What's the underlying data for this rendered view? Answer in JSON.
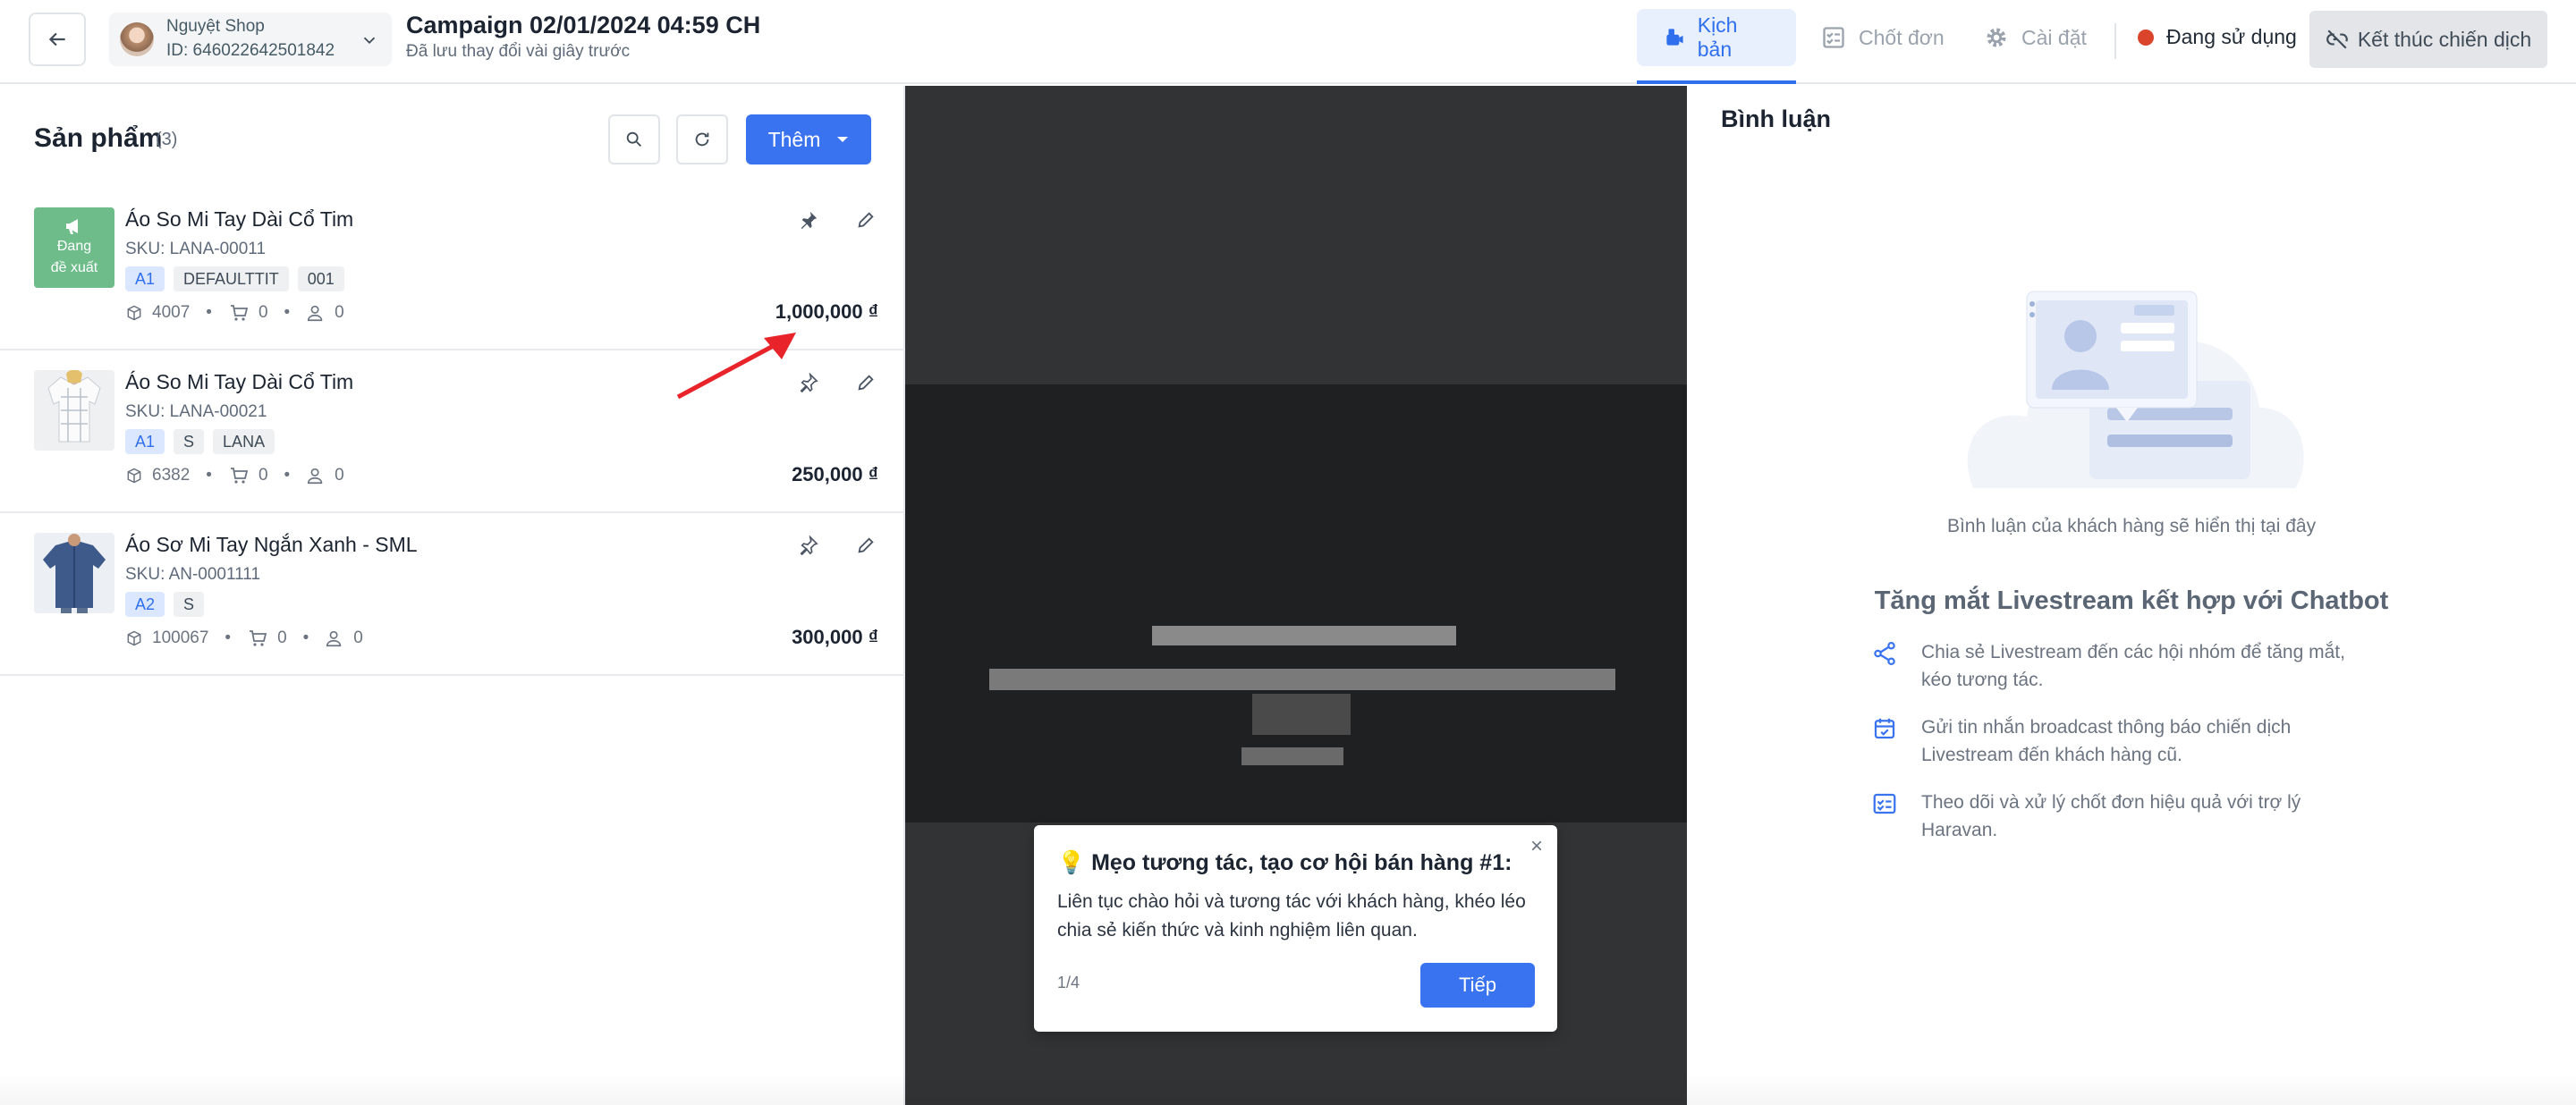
{
  "header": {
    "back_icon": "arrow-left-icon",
    "shop": {
      "name": "Nguyệt Shop",
      "id": "ID: 646022642501842"
    },
    "campaign_title": "Campaign 02/01/2024 04:59 CH",
    "campaign_subtitle": "Đã lưu thay đổi vài giây trước",
    "tabs": [
      {
        "label": "Kịch bản",
        "icon": "script-icon",
        "active": true
      },
      {
        "label": "Chốt đơn",
        "icon": "checklist-icon",
        "active": false
      },
      {
        "label": "Cài đặt",
        "icon": "gear-icon",
        "active": false
      }
    ],
    "status_label": "Đang sử dụng",
    "end_button": "Kết thúc chiến dịch",
    "colors": {
      "accent": "#2f6fed",
      "status": "#d9442b"
    }
  },
  "products": {
    "title": "Sản phẩm",
    "count": "(3)",
    "add_label": "Thêm",
    "items": [
      {
        "name": "Áo So Mi Tay Dài Cổ Tim",
        "sku": "SKU: LANA-00011",
        "tags": [
          "A1",
          "DEFAULTTIT",
          "001"
        ],
        "stock": "4007",
        "cart": "0",
        "users": "0",
        "price": "1,000,000 ₫",
        "featured": true,
        "featured_label_1": "Đang",
        "featured_label_2": "đề xuất"
      },
      {
        "name": "Áo So Mi Tay Dài Cổ Tim",
        "sku": "SKU: LANA-00021",
        "tags": [
          "A1",
          "S",
          "LANA"
        ],
        "stock": "6382",
        "cart": "0",
        "users": "0",
        "price": "250,000 ₫",
        "featured": false
      },
      {
        "name": "Áo Sơ Mi Tay Ngắn Xanh - SML",
        "sku": "SKU: AN-0001111",
        "tags": [
          "A2",
          "S"
        ],
        "stock": "100067",
        "cart": "0",
        "users": "0",
        "price": "300,000 ₫",
        "featured": false
      }
    ]
  },
  "tip": {
    "title": "💡 Mẹo tương tác, tạo cơ hội bán hàng #1:",
    "body": "Liên tục chào hỏi và tương tác với khách hàng, khéo léo chia sẻ kiến thức và kinh nghiệm liên quan.",
    "step": "1/4",
    "next_label": "Tiếp",
    "close": "×"
  },
  "comments": {
    "title": "Bình luận",
    "empty_text": "Bình luận của khách hàng sẽ hiển thị tại đây",
    "promo_title": "Tăng mắt Livestream kết hợp với Chatbot",
    "promo_items": [
      {
        "icon": "share-icon",
        "text": "Chia sẻ Livestream đến các hội nhóm để tăng mắt, kéo tương tác."
      },
      {
        "icon": "calendar-check-icon",
        "text": "Gửi tin nhắn broadcast thông báo chiến dịch Livestream đến khách hàng cũ."
      },
      {
        "icon": "checklist-icon",
        "text": "Theo dõi và xử lý chốt đơn hiệu quả với trợ lý Haravan."
      }
    ]
  }
}
